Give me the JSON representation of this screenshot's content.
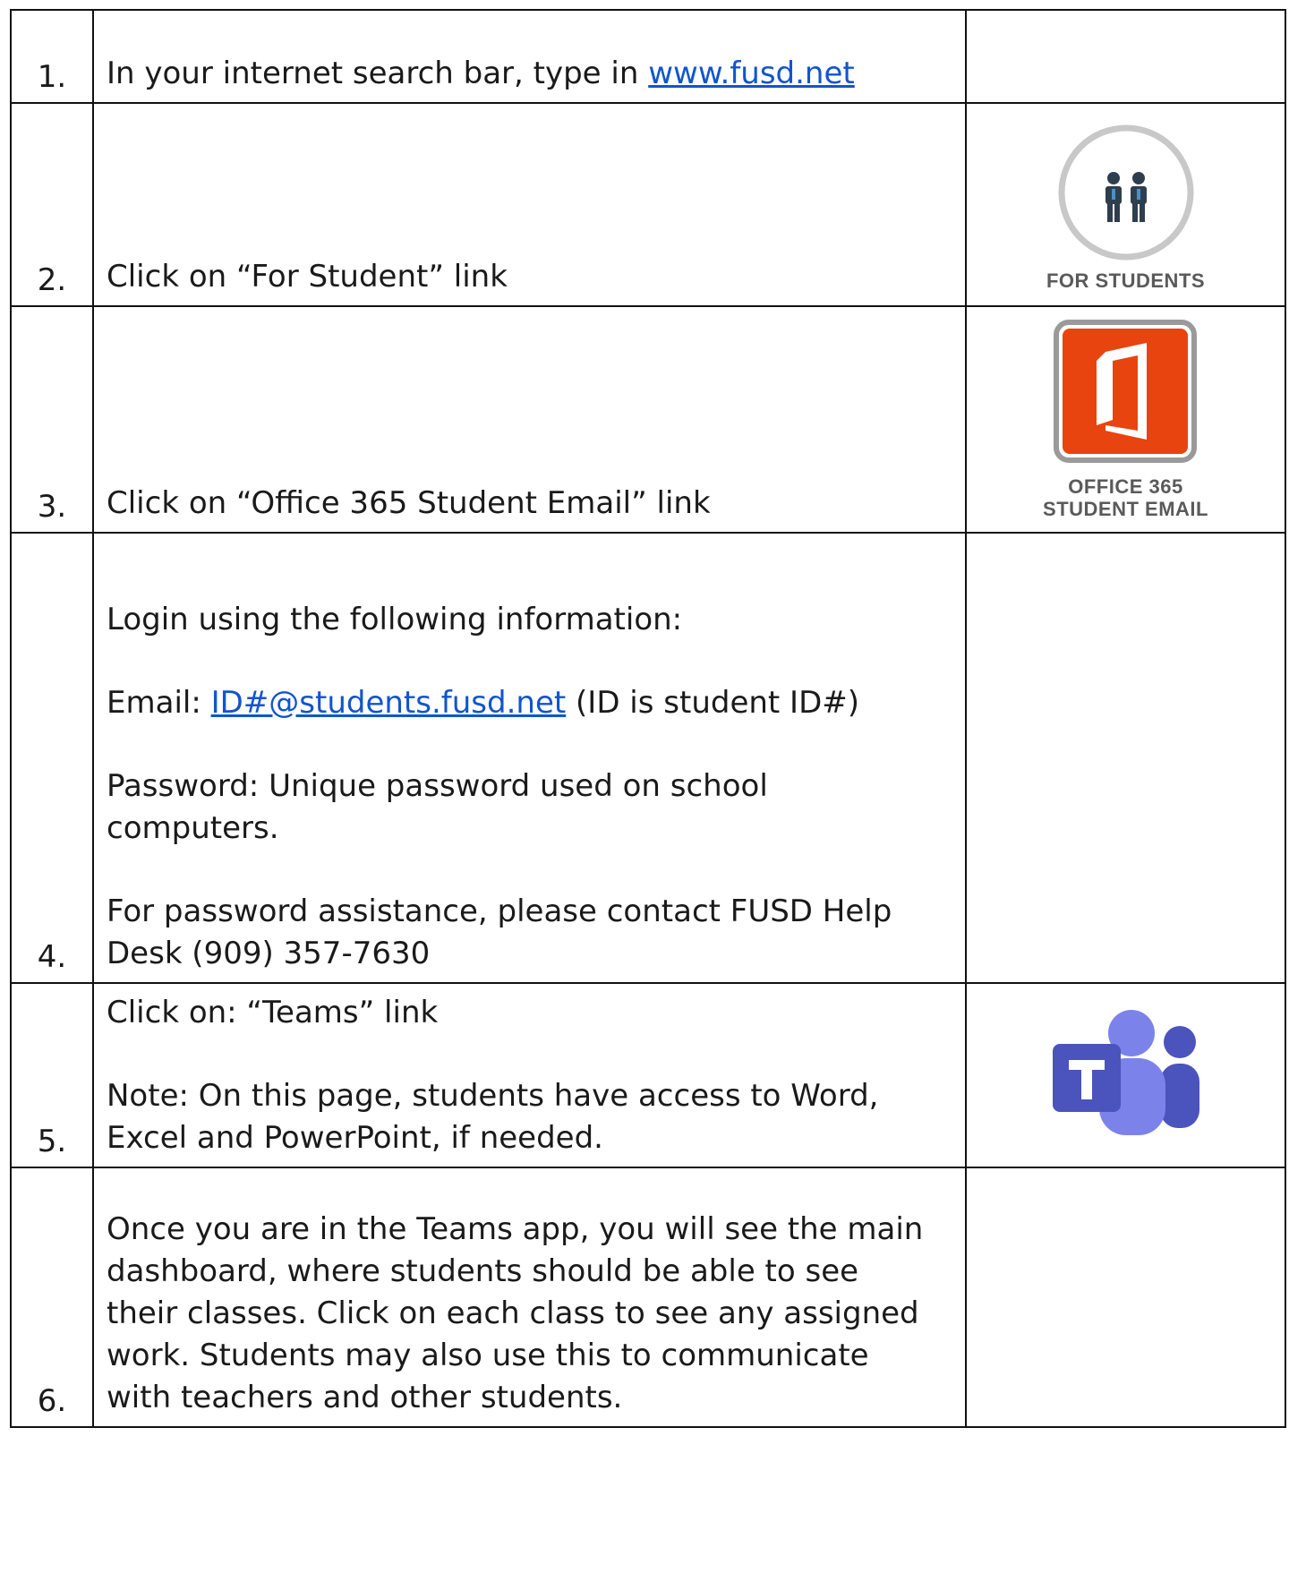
{
  "steps": [
    {
      "number": "1.",
      "text_before": "In your internet search bar, type in ",
      "link": "www.fusd.net"
    },
    {
      "number": "2.",
      "text": "Click on “For Student” link",
      "image": {
        "icon": "students-icon",
        "caption": "FOR STUDENTS",
        "ring_color": "#c8c8c8",
        "figure_color": "#2f3e4e"
      }
    },
    {
      "number": "3.",
      "text": "Click on “Office 365 Student Email” link",
      "image": {
        "icon": "office-365-icon",
        "caption_line1": "OFFICE 365",
        "caption_line2": "STUDENT EMAIL",
        "tile_color": "#e84410",
        "frame_color": "#9a9a9a"
      }
    },
    {
      "number": "4.",
      "intro": "Login using the following information:",
      "email_label": "Email: ",
      "email_link": "ID#@students.fusd.net",
      "email_note": " (ID is student ID#)",
      "password": "Password: Unique password used on school computers.",
      "help": "For password assistance, please contact FUSD Help Desk (909) 357-7630"
    },
    {
      "number": "5.",
      "text": "Click on: “Teams” link",
      "note": "Note: On this page, students have access to Word, Excel and PowerPoint, if needed.",
      "image": {
        "icon": "teams-icon",
        "color_dark": "#4b53bc",
        "color_light": "#7b83eb"
      }
    },
    {
      "number": "6.",
      "text": "Once you are in the Teams app, you will see the main dashboard, where students should be able to see their classes. Click on each class to see any assigned work. Students may also use this to communicate with teachers and other students."
    }
  ],
  "colors": {
    "link": "#1155cc",
    "border": "#111111"
  }
}
